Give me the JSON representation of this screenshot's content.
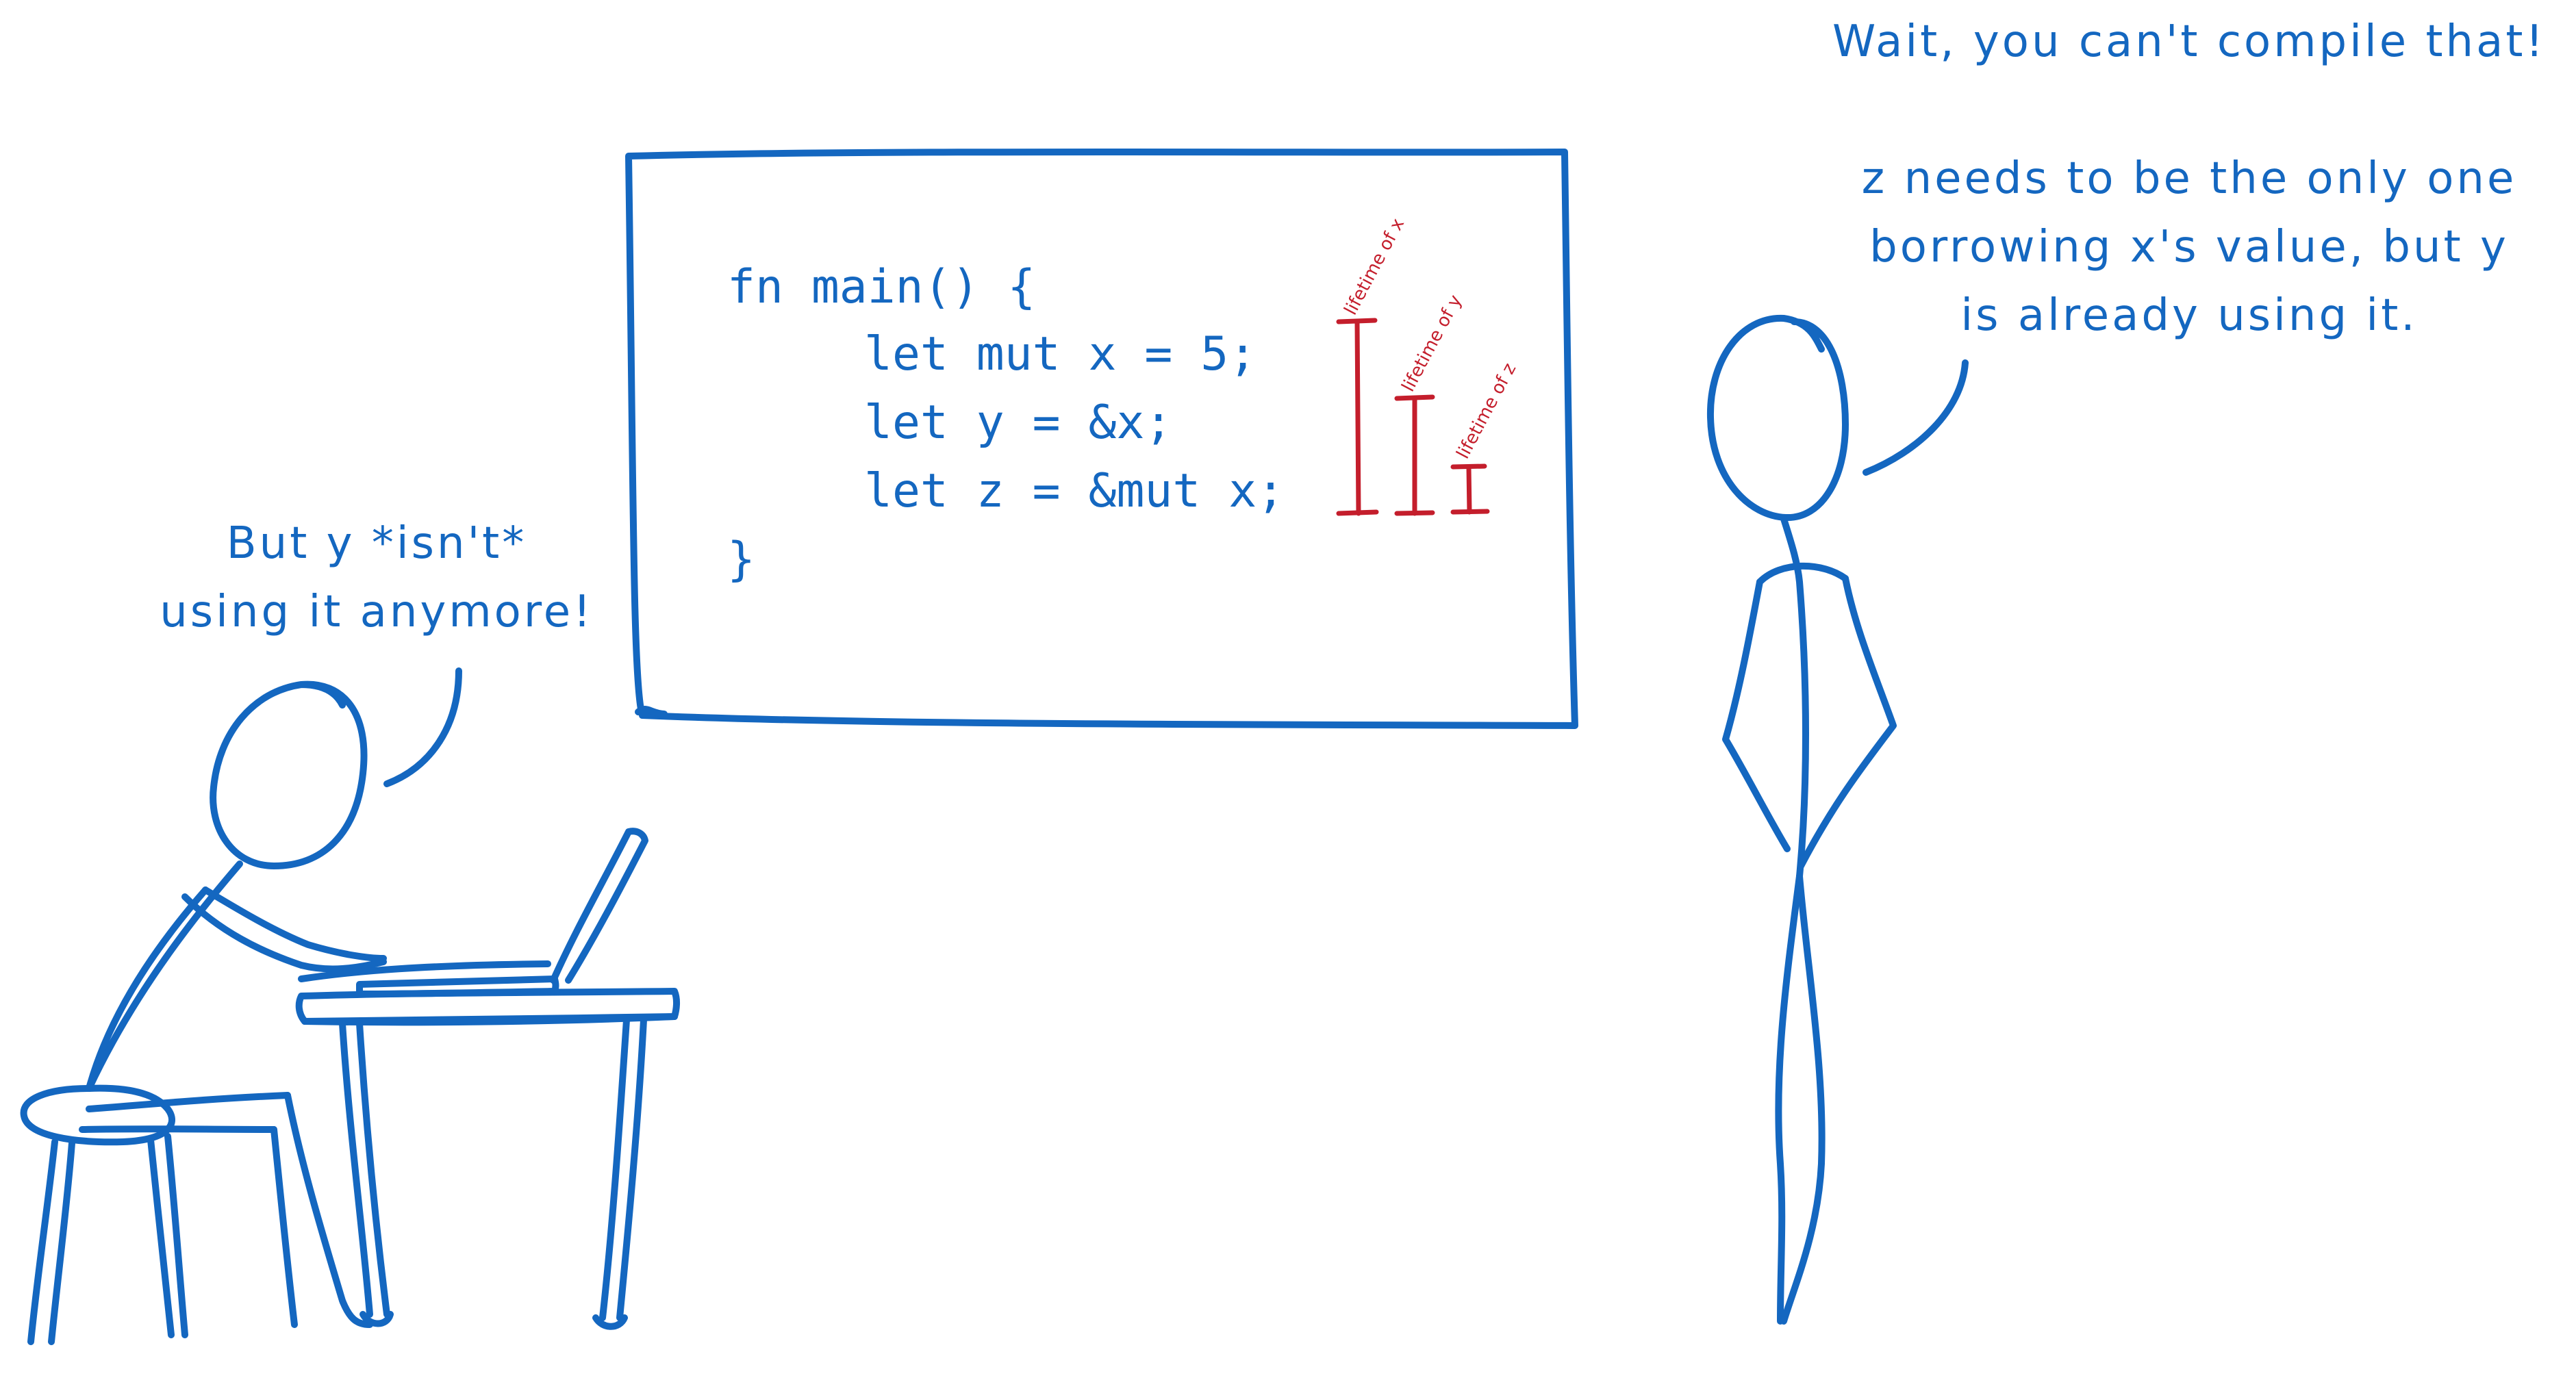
{
  "colors": {
    "ink": "#1467c0",
    "annotation": "#c41e2c",
    "background": "#ffffff"
  },
  "board": {
    "code_lines": [
      "fn main() {",
      "let mut x = 5;",
      "let y = &x;",
      "let z = &mut x;",
      "}"
    ],
    "lifetime_labels": [
      "lifetime of x",
      "lifetime of y",
      "lifetime of z"
    ]
  },
  "speech": {
    "standing_person": {
      "lines": [
        "Wait, you can't compile that!",
        "",
        "z needs to be the only one",
        "borrowing x's value, but y",
        "is already using it."
      ]
    },
    "seated_person": {
      "lines": [
        "But y *isn't*",
        "using it anymore!"
      ]
    }
  }
}
